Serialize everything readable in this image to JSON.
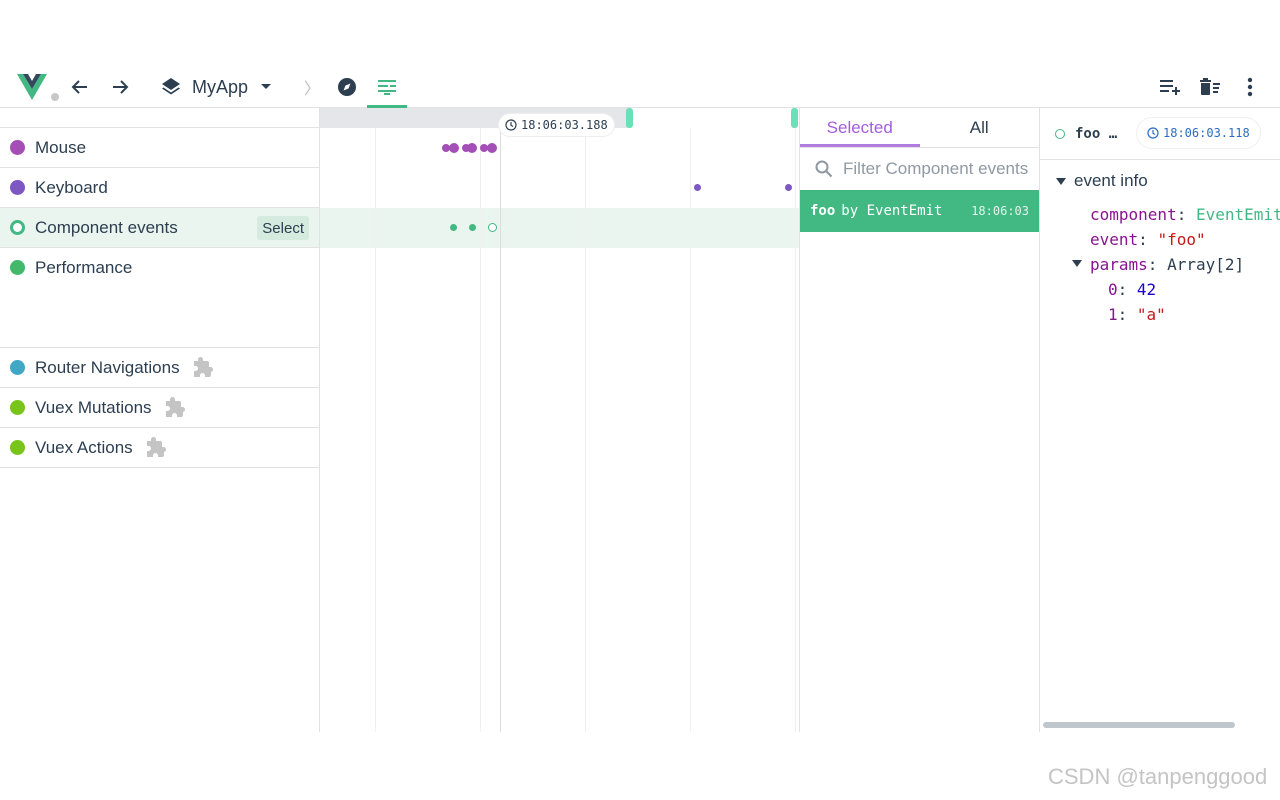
{
  "toolbar": {
    "app_name": "MyApp",
    "separator": "〉"
  },
  "layers": [
    {
      "label": "Mouse",
      "color": "#a34fb5"
    },
    {
      "label": "Keyboard",
      "color": "#7e57c2"
    },
    {
      "label": "Component events",
      "color": "#42b883",
      "selected": true,
      "select_label": "Select"
    },
    {
      "label": "Performance",
      "color": "#41b86a"
    },
    {
      "label": "Router Navigations",
      "color": "#41a7c5"
    },
    {
      "label": "Vuex Mutations",
      "color": "#78c41a"
    },
    {
      "label": "Vuex Actions",
      "color": "#78c41a"
    }
  ],
  "timeline": {
    "cursor_time": "18:06:03.188"
  },
  "events": {
    "tabs": [
      "Selected",
      "All"
    ],
    "active_tab": "Selected",
    "filter_placeholder": "Filter Component events",
    "items": [
      {
        "title": "foo",
        "subtitle": "by EventEmit",
        "time": "18:06:03"
      }
    ]
  },
  "inspector": {
    "title": "foo …",
    "time": "18:06:03.118",
    "section": "event info",
    "props": {
      "component_key": "component",
      "component_val": "EventEmit",
      "event_key": "event",
      "event_val": "\"foo\"",
      "params_key": "params",
      "params_val": "Array[2]",
      "p0_key": "0",
      "p0_val": "42",
      "p1_key": "1",
      "p1_val": "\"a\""
    }
  },
  "watermark": "CSDN @tanpenggood",
  "colors": {
    "accent_green": "#42b883",
    "accent_purple": "#a35ddc"
  }
}
